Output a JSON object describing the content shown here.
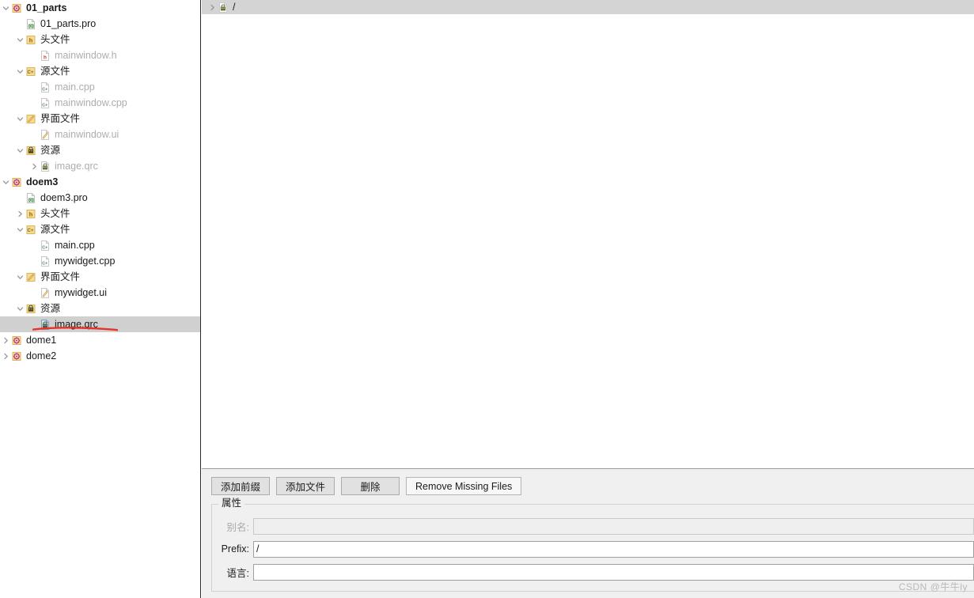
{
  "sidebar": {
    "tree": [
      {
        "depth": 0,
        "chevron": "down",
        "icon": "project-icon",
        "label": "01_parts",
        "bold": true,
        "dim": false,
        "selected": false
      },
      {
        "depth": 1,
        "chevron": "none",
        "icon": "pro-file-icon",
        "label": "01_parts.pro",
        "bold": false,
        "dim": false,
        "selected": false
      },
      {
        "depth": 1,
        "chevron": "down",
        "icon": "h-folder-icon",
        "label": "头文件",
        "bold": false,
        "dim": false,
        "selected": false
      },
      {
        "depth": 2,
        "chevron": "none",
        "icon": "h-file-icon",
        "label": "mainwindow.h",
        "bold": false,
        "dim": true,
        "selected": false
      },
      {
        "depth": 1,
        "chevron": "down",
        "icon": "cpp-folder-icon",
        "label": "源文件",
        "bold": false,
        "dim": false,
        "selected": false
      },
      {
        "depth": 2,
        "chevron": "none",
        "icon": "cpp-file-icon",
        "label": "main.cpp",
        "bold": false,
        "dim": true,
        "selected": false
      },
      {
        "depth": 2,
        "chevron": "none",
        "icon": "cpp-file-icon",
        "label": "mainwindow.cpp",
        "bold": false,
        "dim": true,
        "selected": false
      },
      {
        "depth": 1,
        "chevron": "down",
        "icon": "ui-folder-icon",
        "label": "界面文件",
        "bold": false,
        "dim": false,
        "selected": false
      },
      {
        "depth": 2,
        "chevron": "none",
        "icon": "ui-file-icon",
        "label": "mainwindow.ui",
        "bold": false,
        "dim": true,
        "selected": false
      },
      {
        "depth": 1,
        "chevron": "down",
        "icon": "qrc-folder-icon",
        "label": "资源",
        "bold": false,
        "dim": false,
        "selected": false
      },
      {
        "depth": 2,
        "chevron": "right",
        "icon": "qrc-file-icon",
        "label": "image.qrc",
        "bold": false,
        "dim": true,
        "selected": false
      },
      {
        "depth": 0,
        "chevron": "down",
        "icon": "project-icon",
        "label": "doem3",
        "bold": true,
        "dim": false,
        "selected": false
      },
      {
        "depth": 1,
        "chevron": "none",
        "icon": "pro-file-icon",
        "label": "doem3.pro",
        "bold": false,
        "dim": false,
        "selected": false
      },
      {
        "depth": 1,
        "chevron": "right",
        "icon": "h-folder-icon",
        "label": "头文件",
        "bold": false,
        "dim": false,
        "selected": false
      },
      {
        "depth": 1,
        "chevron": "down",
        "icon": "cpp-folder-icon",
        "label": "源文件",
        "bold": false,
        "dim": false,
        "selected": false
      },
      {
        "depth": 2,
        "chevron": "none",
        "icon": "cpp-file-icon",
        "label": "main.cpp",
        "bold": false,
        "dim": false,
        "selected": false
      },
      {
        "depth": 2,
        "chevron": "none",
        "icon": "cpp-file-icon",
        "label": "mywidget.cpp",
        "bold": false,
        "dim": false,
        "selected": false
      },
      {
        "depth": 1,
        "chevron": "down",
        "icon": "ui-folder-icon",
        "label": "界面文件",
        "bold": false,
        "dim": false,
        "selected": false
      },
      {
        "depth": 2,
        "chevron": "none",
        "icon": "ui-file-icon",
        "label": "mywidget.ui",
        "bold": false,
        "dim": false,
        "selected": false
      },
      {
        "depth": 1,
        "chevron": "down",
        "icon": "qrc-folder-icon",
        "label": "资源",
        "bold": false,
        "dim": false,
        "selected": false
      },
      {
        "depth": 2,
        "chevron": "none",
        "icon": "qrc-file-sel-icon",
        "label": "image.qrc",
        "bold": false,
        "dim": false,
        "selected": true
      },
      {
        "depth": 0,
        "chevron": "right",
        "icon": "project-icon",
        "label": "dome1",
        "bold": false,
        "dim": false,
        "selected": false
      },
      {
        "depth": 0,
        "chevron": "right",
        "icon": "project-icon",
        "label": "dome2",
        "bold": false,
        "dim": false,
        "selected": false
      }
    ],
    "annotation_color": "#e8322a"
  },
  "editor": {
    "qrc_tree": [
      {
        "chevron": "right",
        "icon": "qrc-file-icon",
        "label": "/"
      }
    ]
  },
  "bottom": {
    "buttons": [
      {
        "label": "添加前缀",
        "style": "wide"
      },
      {
        "label": "添加文件",
        "style": "wide"
      },
      {
        "label": "删除",
        "style": "wide"
      },
      {
        "label": "Remove Missing Files",
        "style": "plain"
      }
    ],
    "group_title": "属性",
    "fields": [
      {
        "label": "别名:",
        "value": "",
        "disabled": true
      },
      {
        "label": "Prefix:",
        "value": "/",
        "disabled": false
      },
      {
        "label": "语言:",
        "value": "",
        "disabled": false
      }
    ]
  },
  "watermark": "CSDN @牛牛ly"
}
